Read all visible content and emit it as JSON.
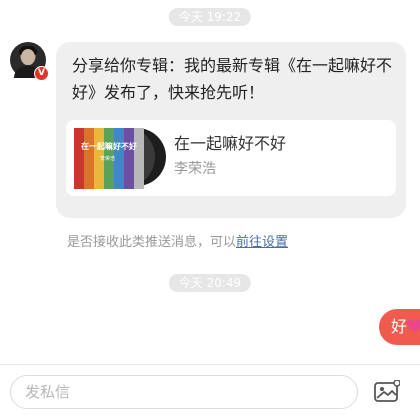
{
  "timestamps": [
    "今天 19:22",
    "今天 20:49"
  ],
  "incoming_message": {
    "text": "分享给你专辑：我的最新专辑《在一起嘛好不好》发布了，快来抢先听！",
    "badge": "V",
    "album": {
      "title": "在一起嘛好不好",
      "artist": "李荣浩",
      "cover_title": "在一起嘛好不好",
      "cover_artist": "李荣浩",
      "cover_colors": [
        "#c8372d",
        "#d9742a",
        "#e9b83a",
        "#5aa25a",
        "#3f87c6",
        "#6a4fa3",
        "#b8b8b8"
      ]
    }
  },
  "notice": {
    "text": "是否接收此类推送消息，可以",
    "link": "前往设置"
  },
  "outgoing_message": {
    "text": "好",
    "emoji": "heart-icon"
  },
  "composer": {
    "placeholder": "发私信",
    "image_button": "image-icon"
  },
  "colors": {
    "outgoing_bubble": "#f05a4f",
    "incoming_bubble": "#efeff0",
    "link": "#4a6fa5",
    "timestamp_bg": "#e6e6e6"
  }
}
